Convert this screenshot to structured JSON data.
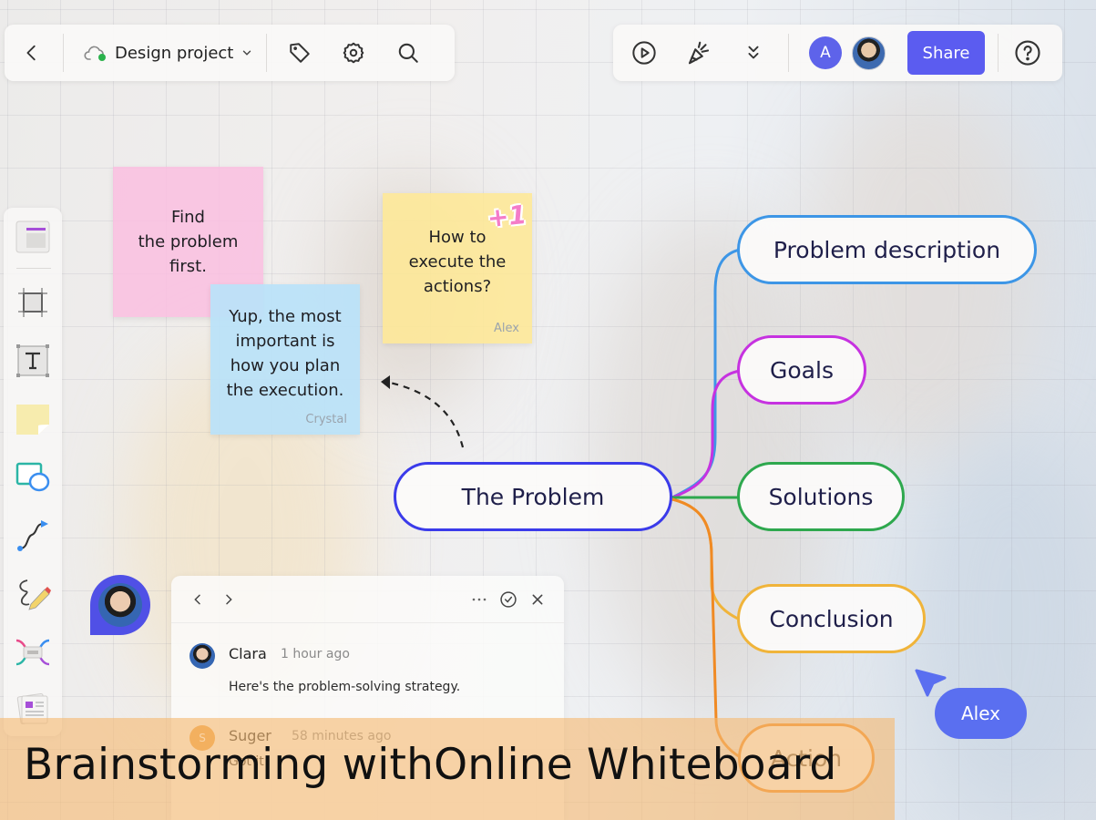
{
  "header_left": {
    "back_label": "Back",
    "project_name": "Design project",
    "sync_status": "online",
    "icons": [
      "chevron-left-icon",
      "cloud-icon",
      "chevron-down-icon",
      "tag-icon",
      "gear-icon",
      "search-icon"
    ]
  },
  "header_right": {
    "icons": [
      "play-icon",
      "celebrate-icon",
      "chevrons-down-icon",
      "help-icon"
    ],
    "collaborators": [
      {
        "initial": "A",
        "color": "#5e63ea"
      },
      {
        "initial": "",
        "type": "photo"
      }
    ],
    "share_label": "Share",
    "share_color": "#5b5cf0"
  },
  "toolbar": {
    "tools": [
      {
        "name": "templates"
      },
      {
        "name": "frame"
      },
      {
        "name": "text"
      },
      {
        "name": "sticky-note"
      },
      {
        "name": "shapes"
      },
      {
        "name": "connector"
      },
      {
        "name": "pen"
      },
      {
        "name": "mind-map"
      },
      {
        "name": "more-templates"
      }
    ]
  },
  "stickies": [
    {
      "id": "pink",
      "lines": [
        "Find",
        "the problem",
        "first."
      ],
      "author": "",
      "color": "#f9bde1"
    },
    {
      "id": "blue",
      "lines": [
        "Yup, the most",
        "important is",
        "how you plan",
        "the execution."
      ],
      "author": "Crystal",
      "color": "#bae2f8"
    },
    {
      "id": "yellow",
      "lines": [
        "How to",
        "execute the",
        "actions?"
      ],
      "author": "Alex",
      "color": "#fee896",
      "sticker": "+1"
    }
  ],
  "mindmap": {
    "root": {
      "label": "The Problem",
      "color": "#3b3bea"
    },
    "children": [
      {
        "label": "Problem description",
        "color": "#3d96e6"
      },
      {
        "label": "Goals",
        "color": "#c632e0"
      },
      {
        "label": "Solutions",
        "color": "#2ea84e"
      },
      {
        "label": "Conclusion",
        "color": "#f0b43a"
      },
      {
        "label": "Action",
        "color": "#f08a24"
      }
    ]
  },
  "comments": {
    "nav": [
      "prev",
      "next"
    ],
    "actions": [
      "more",
      "resolve",
      "close"
    ],
    "items": [
      {
        "author": "Clara",
        "time": "1 hour ago",
        "text": "Here's the problem-solving strategy.",
        "avatar": "photo"
      },
      {
        "author": "Suger",
        "time": "58 minutes ago",
        "text": "Got it",
        "avatar_initial": "S",
        "avatar_color": "#f0a040"
      }
    ]
  },
  "cursor": {
    "user": "Alex",
    "color": "#5a6ff0"
  },
  "caption": "Brainstorming withOnline Whiteboard"
}
